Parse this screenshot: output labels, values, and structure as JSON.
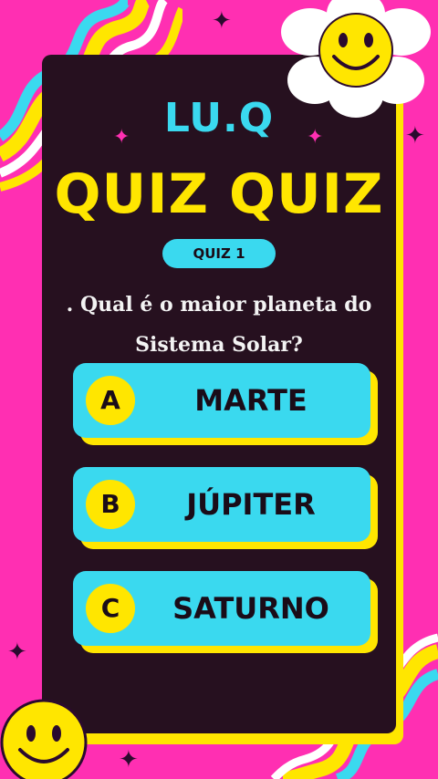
{
  "brand": "LU.Q",
  "title_part1": "QUIZ",
  "title_part2": "QUIZ",
  "quiz_label": "QUIZ 1",
  "question": {
    "line1": ". Qual é o maior planeta do",
    "line2": "Sistema Solar?"
  },
  "options": [
    {
      "letter": "A",
      "text": "MARTE"
    },
    {
      "letter": "B",
      "text": "JÚPITER"
    },
    {
      "letter": "C",
      "text": "SATURNO"
    }
  ],
  "colors": {
    "background": "#ff2fb2",
    "card": "#26101f",
    "accent_yellow": "#ffe600",
    "accent_cyan": "#3ad9ef"
  }
}
